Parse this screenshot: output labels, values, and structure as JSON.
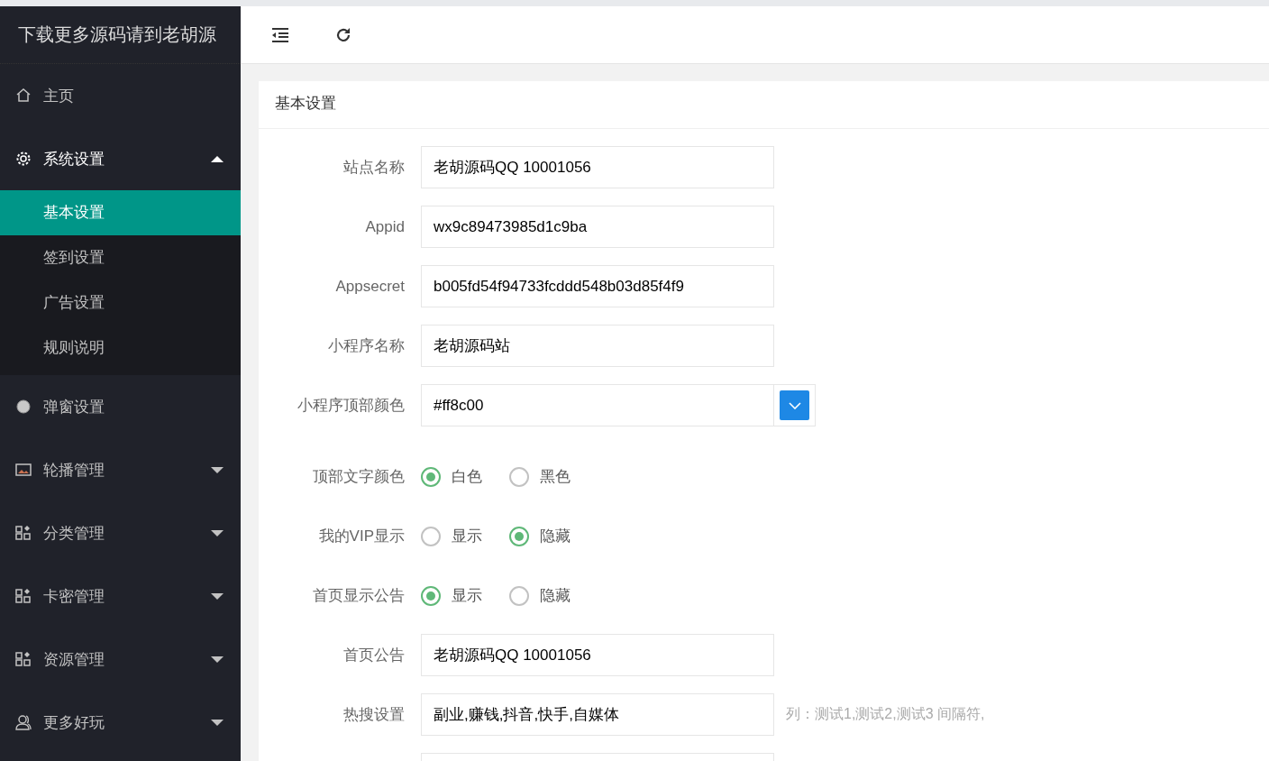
{
  "sidebar": {
    "logo": "下载更多源码请到老胡源",
    "items": [
      {
        "label": "主页"
      },
      {
        "label": "系统设置",
        "expanded": true,
        "children": [
          {
            "label": "基本设置",
            "selected": true
          },
          {
            "label": "签到设置",
            "selected": false
          },
          {
            "label": "广告设置",
            "selected": false
          },
          {
            "label": "规则说明",
            "selected": false
          }
        ]
      },
      {
        "label": "弹窗设置"
      },
      {
        "label": "轮播管理",
        "expanded": false
      },
      {
        "label": "分类管理",
        "expanded": false
      },
      {
        "label": "卡密管理",
        "expanded": false
      },
      {
        "label": "资源管理",
        "expanded": false
      },
      {
        "label": "更多好玩",
        "expanded": false
      }
    ]
  },
  "card": {
    "title": "基本设置",
    "fields": [
      {
        "kind": "text",
        "label": "站点名称",
        "value": "老胡源码QQ 10001056"
      },
      {
        "kind": "text",
        "label": "Appid",
        "value": "wx9c89473985d1c9ba"
      },
      {
        "kind": "text",
        "label": "Appsecret",
        "value": "b005fd54f94733fcddd548b03d85f4f9"
      },
      {
        "kind": "text",
        "label": "小程序名称",
        "value": "老胡源码站"
      },
      {
        "kind": "color",
        "label": "小程序顶部颜色",
        "value": "#ff8c00"
      },
      {
        "kind": "radio",
        "label": "顶部文字颜色",
        "options": [
          {
            "label": "白色",
            "selected": true
          },
          {
            "label": "黑色",
            "selected": false
          }
        ]
      },
      {
        "kind": "radio",
        "label": "我的VIP显示",
        "options": [
          {
            "label": "显示",
            "selected": false
          },
          {
            "label": "隐藏",
            "selected": true
          }
        ]
      },
      {
        "kind": "radio",
        "label": "首页显示公告",
        "options": [
          {
            "label": "显示",
            "selected": true
          },
          {
            "label": "隐藏",
            "selected": false
          }
        ]
      },
      {
        "kind": "text",
        "label": "首页公告",
        "value": "老胡源码QQ 10001056"
      },
      {
        "kind": "text",
        "label": "热搜设置",
        "value": "副业,赚钱,抖音,快手,自媒体",
        "hint": "列：测试1,测试2,测试3 间隔符,"
      },
      {
        "kind": "text"
      }
    ]
  }
}
